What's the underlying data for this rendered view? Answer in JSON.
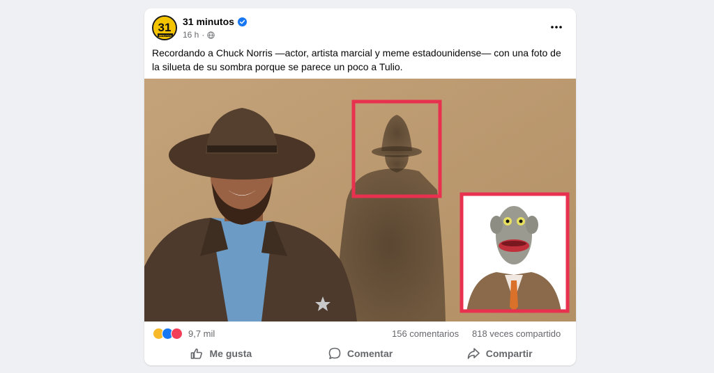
{
  "post": {
    "author": "31 minutos",
    "avatar_text": "31",
    "avatar_subtext": "MINUTOS",
    "time": "16 h",
    "caption": "Recordando a Chuck Norris —actor, artista marcial y meme estadounidense— con una foto de la silueta de su sombra porque se parece un poco a Tulio."
  },
  "stats": {
    "reactions": "9,7 mil",
    "comments": "156 comentarios",
    "shares": "818 veces compartido"
  },
  "actions": {
    "like": "Me gusta",
    "comment": "Comentar",
    "share": "Compartir"
  },
  "colors": {
    "verified": "#1877f2",
    "highlight_box": "#e8314f",
    "wall": "#b8956a",
    "like_reaction": "#1877f2",
    "love_reaction": "#f33e58",
    "haha_reaction": "#f7b928"
  },
  "icons": [
    "verified-icon",
    "globe-icon",
    "more-options-icon",
    "like-icon",
    "comment-icon",
    "share-icon"
  ]
}
